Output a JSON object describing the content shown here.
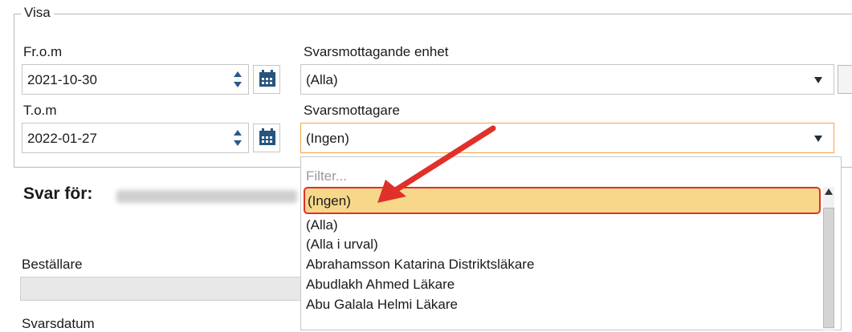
{
  "visa": {
    "legend": "Visa",
    "from_label": "Fr.o.m",
    "from_value": "2021-10-30",
    "tom_label": "T.o.m",
    "tom_value": "2022-01-27",
    "unit_label": "Svarsmottagande enhet",
    "unit_value": "(Alla)",
    "recipient_label": "Svarsmottagare",
    "recipient_value": "(Ingen)"
  },
  "background": {
    "svar_for": "Svar för:",
    "bestallare": "Beställare",
    "svarsdatum": "Svarsdatum"
  },
  "dropdown": {
    "filter_placeholder": "Filter...",
    "selected": "(Ingen)",
    "items": [
      "(Alla)",
      "(Alla i urval)",
      "Abrahamsson Katarina Distriktsläkare",
      "Abudlakh Ahmed Läkare",
      "Abu Galala Helmi Läkare"
    ]
  },
  "colors": {
    "highlight": "#f7d88a",
    "annotation_red": "#e0302a",
    "icon_blue": "#25547e",
    "focus_orange": "#f0a64a"
  }
}
